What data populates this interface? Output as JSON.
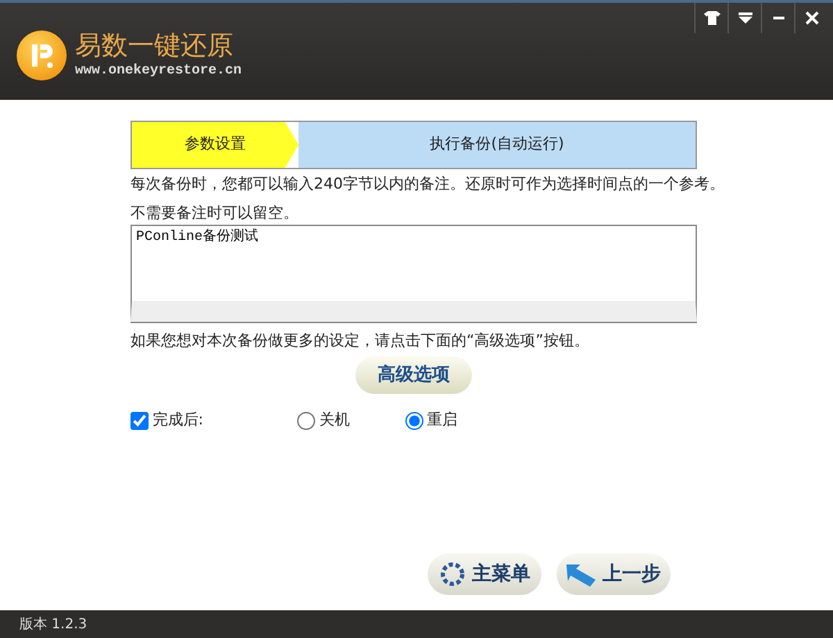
{
  "header": {
    "title": "易数一键还原",
    "url": "www.onekeyrestore.cn"
  },
  "steps": [
    {
      "label": "参数设置",
      "selected": true
    },
    {
      "label": "执行备份(自动运行)",
      "selected": false
    }
  ],
  "intro": "每次备份时，您都可以输入240字节以内的备注。还原时可作为选择时间点的一个参考。",
  "hint": "不需要备注时可以留空。",
  "note": {
    "value": "PConline备份测试"
  },
  "advanced_hint": "如果您想对本次备份做更多的设定，请点击下面的“高级选项”按钮。",
  "advanced_button": "高级选项",
  "after": {
    "label": "完成后:",
    "checked": true,
    "options": [
      {
        "label": "关机",
        "selected": false
      },
      {
        "label": "重启",
        "selected": true
      }
    ]
  },
  "buttons": [
    {
      "kind": "menu",
      "label": "主菜单"
    },
    {
      "kind": "back",
      "label": "上一步"
    }
  ],
  "status_bar": "版本 1.2.3"
}
